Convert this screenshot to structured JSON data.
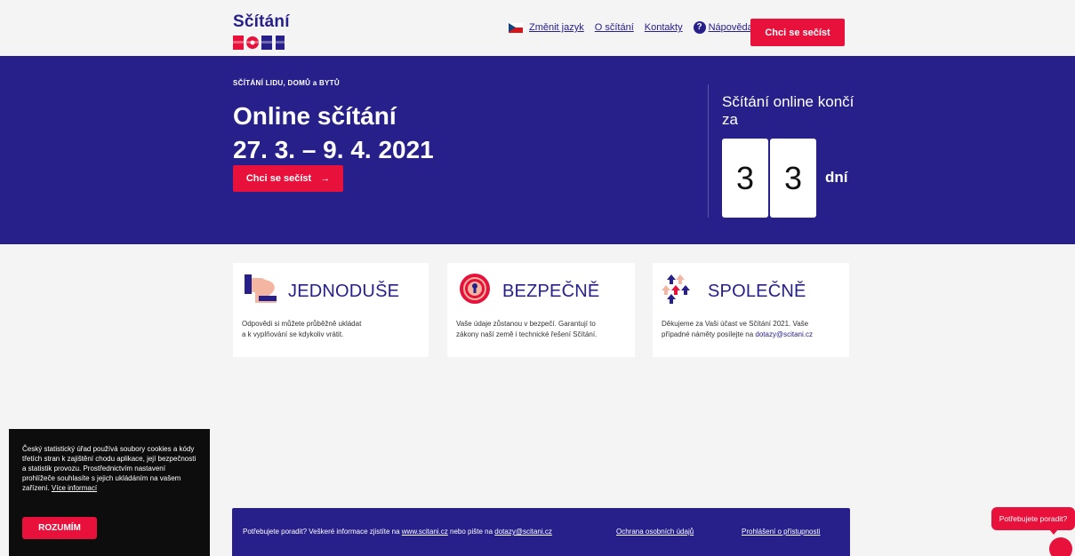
{
  "header": {
    "logo_word": "Sčítání",
    "logo_year": "2021",
    "nav": {
      "lang": "Změnit jazyk",
      "about": "O sčítání",
      "contacts": "Kontakty",
      "help": "Nápověda"
    },
    "cta": "Chci se sečíst"
  },
  "hero": {
    "kicker": "SČÍTÁNÍ LIDU, DOMŮ a BYTŮ",
    "title": "Online sčítání",
    "dates": "27. 3. – 9. 4. 2021",
    "cta": "Chci se sečíst",
    "cta_arrow": "→",
    "countdown": {
      "title": "Sčítání online končí za",
      "digit1": "3",
      "digit2": "3",
      "unit": "dní"
    }
  },
  "cards": [
    {
      "title": "JEDNODUŠE",
      "text_1": "Odpovědi si můžete průběžně ukládat",
      "text_2": "a k vyplňování se kdykoliv vrátit."
    },
    {
      "title": "BEZPEČNĚ",
      "text_1": "Vaše údaje zůstanou v bezpečí. Garantují to",
      "text_2": "zákony naší země i technické řešení Sčítání."
    },
    {
      "title": "SPOLEČNĚ",
      "text_1": "Děkujeme za Vaši účast ve Sčítání 2021. Vaše",
      "text_2": "případné náměty posílejte na ",
      "email": "dotazy@scitani.cz"
    }
  ],
  "footer": {
    "text_a": "Potřebujete poradit? Veškeré informace zjistíte na ",
    "link_web": "www.scitani.cz",
    "text_b": " nebo pište na ",
    "link_mail": "dotazy@scitani.cz",
    "privacy": "Ochrana osobních údajů",
    "accessibility": "Prohlášení o přístupnosti"
  },
  "cookie": {
    "text": "Český statistický úřad používá soubory cookies a kódy třetích stran k zajištění chodu aplikace, její bezpečnosti a statistik provozu. Prostřednictvím nastavení prohlížeče souhlasíte s jejich ukládáním na vašem zařízení. ",
    "more": "Více informací",
    "button": "ROZUMÍM"
  },
  "chat": {
    "bubble": "Potřebujete poradit?"
  },
  "colors": {
    "brand_blue": "#27208a",
    "brand_red": "#e8113b",
    "page_bg": "#f4f4f4"
  },
  "icons": [
    "flag-cz-icon",
    "help-icon",
    "arrow-right-icon",
    "simple-12-icon",
    "keyhole-icon",
    "arrows-up-icon",
    "chat-icon"
  ]
}
